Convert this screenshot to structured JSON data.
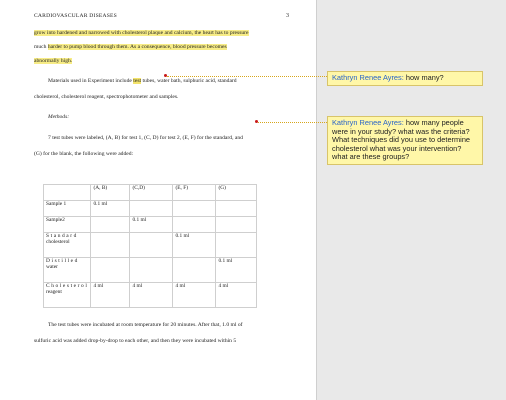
{
  "header": {
    "running_head": "CARDIOVASCULAR DISEASES",
    "page_number": "3"
  },
  "body": {
    "l1_hl": "grow into hardened and narrowed with cholesterol plaque and calcium, the heart has to pressure",
    "l2_plain": "much ",
    "l2_hl": "harder to pump blood through them. As a consequence, blood pressure becomes",
    "l3_hl": "abnormally high.",
    "l4_pre": "Materials used in Experiment include ",
    "l4_hl": "test",
    "l4_post": " tubes, water bath, sulphuric acid, standard",
    "l5": "cholesterol, cholesterol reagent, spectrophotometer and samples.",
    "l6": "Methods:",
    "l7": "7 test tubes were labeled, (A, B) for test 1, (C, D) for test 2, (E, F) for the standard, and",
    "l8": "(G) for the blank, the following were added:",
    "l9": "The test tubes were incubated at room temperature for 20 minutes. After that, 1.0 ml of",
    "l10": "sulfuric acid was added drop-by-drop to each other, and then they were incubated within 5"
  },
  "table": {
    "headers": [
      "",
      "(A, B)",
      "(C,D)",
      "(E, F)",
      "(G)"
    ],
    "rows": [
      {
        "label": "Sample 1",
        "label2": "",
        "cells": [
          "0.1 ml",
          "",
          "",
          ""
        ]
      },
      {
        "label": "Sample2",
        "label2": "",
        "cells": [
          "",
          "0.1 ml",
          "",
          ""
        ]
      },
      {
        "label": "Standard",
        "label2": "cholesterol",
        "cells": [
          "",
          "",
          "0.1 ml",
          ""
        ]
      },
      {
        "label": "Distilled",
        "label2": "water",
        "cells": [
          "",
          "",
          "",
          "0.1 ml"
        ]
      },
      {
        "label": "Cholesterol",
        "label2": "reagent",
        "cells": [
          "4 ml",
          "4 ml",
          "4 ml",
          "4 ml"
        ]
      }
    ]
  },
  "comments": [
    {
      "author": "Kathryn Renee Ayres:",
      "text": "how many?"
    },
    {
      "author": "Kathryn Renee Ayres:",
      "text": "how many people were in your study? what was the criteria? What techniques did you use to determine cholesterol what was your intervention? what are these groups?"
    }
  ],
  "colors": {
    "highlight": "#f7ec86",
    "comment_bg": "#fff7a8",
    "comment_author": "#2a64c8",
    "marker": "#c91a1a"
  }
}
